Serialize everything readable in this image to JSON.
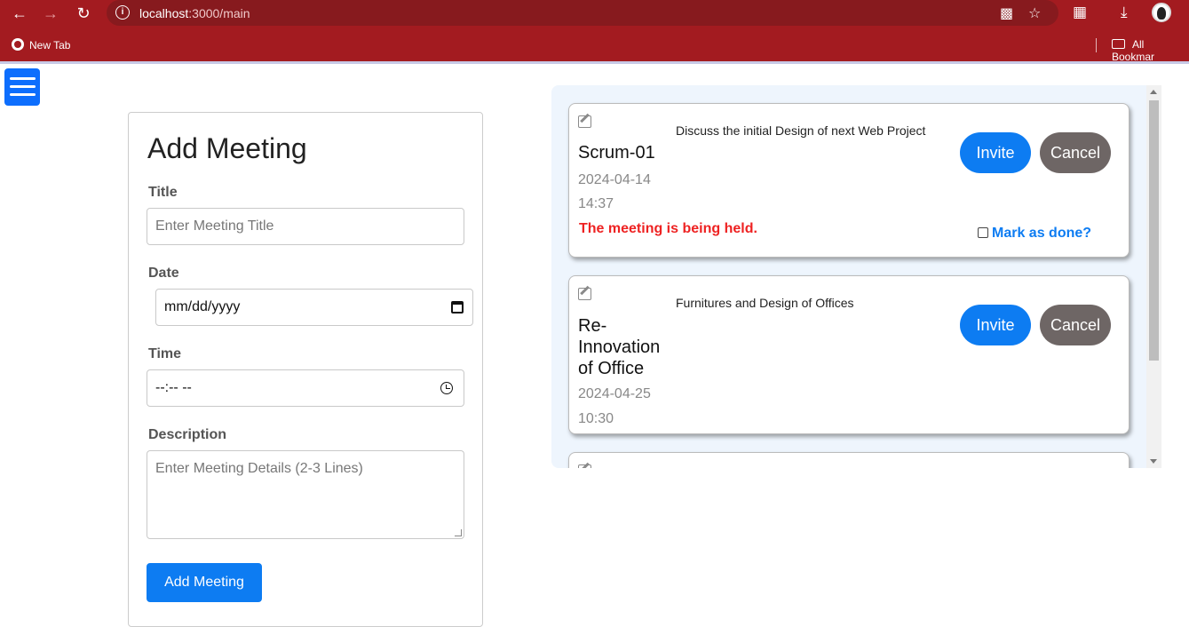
{
  "browser": {
    "url_host": "localhost",
    "url_path": ":3000/main",
    "bookmarks": [
      "New Tab"
    ],
    "all_bookmarks_label": "All Bookmar"
  },
  "form": {
    "heading": "Add Meeting",
    "title_label": "Title",
    "title_placeholder": "Enter Meeting Title",
    "date_label": "Date",
    "date_value": "mm/dd/yyyy",
    "time_label": "Time",
    "time_value": "--:-- --",
    "description_label": "Description",
    "description_placeholder": "Enter Meeting Details (2-3 Lines)",
    "submit_label": "Add Meeting"
  },
  "meetings": [
    {
      "title": "Scrum-01",
      "date": "2024-04-14",
      "time": "14:37",
      "description": "Discuss the initial Design of next Web Project",
      "status": "The meeting is being held.",
      "done_label": "Mark as done?",
      "done_checked": false
    },
    {
      "title": "Re-Innovation of Office",
      "date": "2024-04-25",
      "time": "10:30",
      "description": "Furnitures and Design of Offices"
    }
  ],
  "buttons": {
    "invite": "Invite",
    "cancel": "Cancel"
  },
  "colors": {
    "chrome": "#a31b20",
    "primary": "#0d7cf2",
    "cancel": "#6e6665",
    "status_red": "#ee2222"
  }
}
